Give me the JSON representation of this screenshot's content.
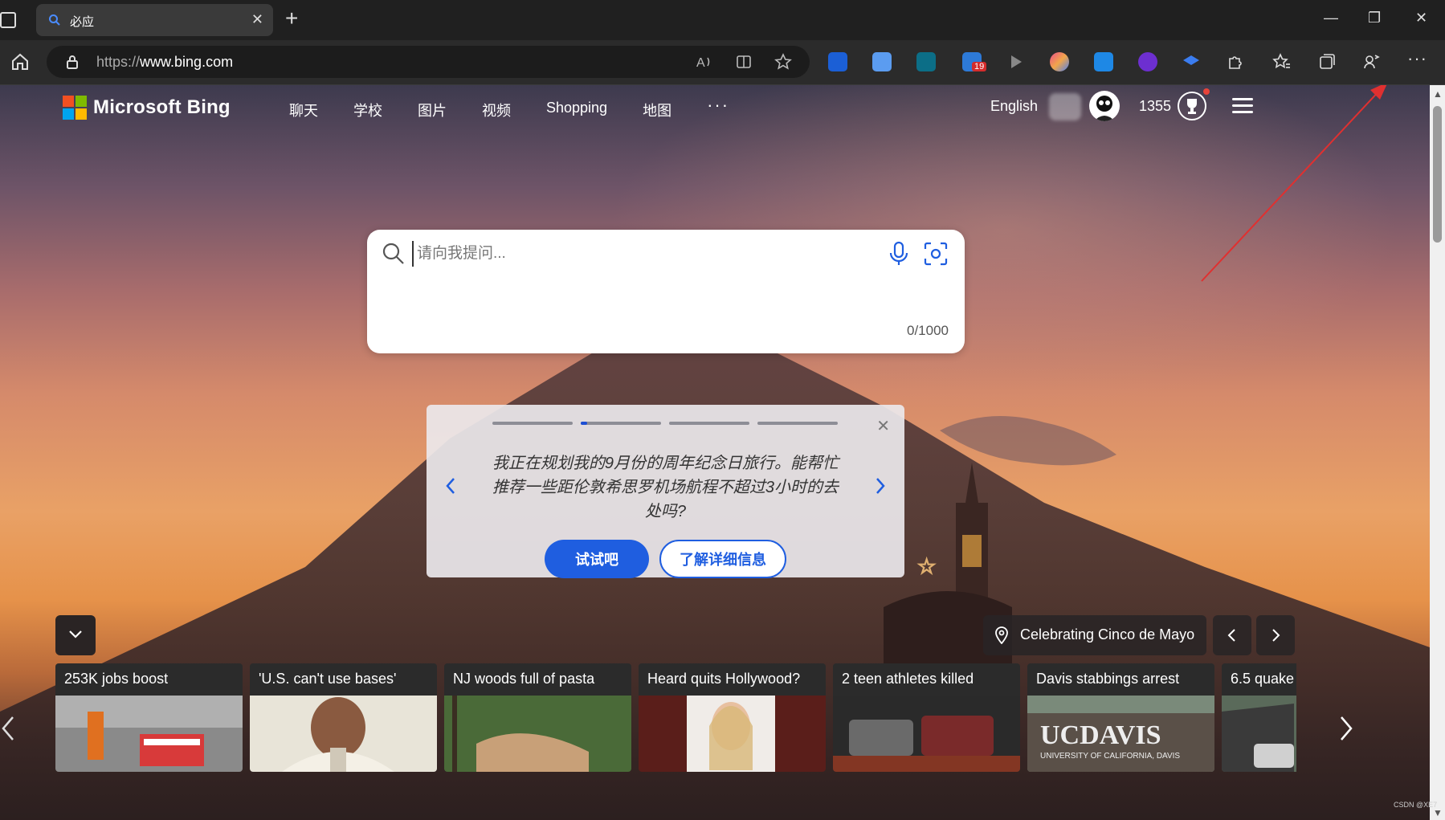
{
  "browser": {
    "tab_title": "必应",
    "url_scheme": "https://",
    "url_host": "www.bing.com",
    "extension_badge": "19"
  },
  "header": {
    "brand": "Microsoft Bing",
    "nav": [
      "聊天",
      "学校",
      "图片",
      "视频",
      "Shopping",
      "地图"
    ],
    "more": "···",
    "language": "English",
    "points": "1355"
  },
  "search": {
    "placeholder": "请向我提问...",
    "char_count": "0/1000"
  },
  "prompt_card": {
    "text": "我正在规划我的9月份的周年纪念日旅行。能帮忙推荐一些距伦敦希思罗机场航程不超过3小时的去处吗?",
    "try_label": "试试吧",
    "learn_label": "了解详细信息"
  },
  "image_info": {
    "location_label": "Celebrating Cinco de Mayo"
  },
  "news": [
    {
      "headline": "253K jobs boost"
    },
    {
      "headline": "'U.S. can't use bases'"
    },
    {
      "headline": "NJ woods full of pasta"
    },
    {
      "headline": "Heard quits Hollywood?"
    },
    {
      "headline": "2 teen athletes killed"
    },
    {
      "headline": "Davis stabbings arrest"
    },
    {
      "headline": "6.5 quake"
    }
  ],
  "watermark": "CSDN @XE7"
}
